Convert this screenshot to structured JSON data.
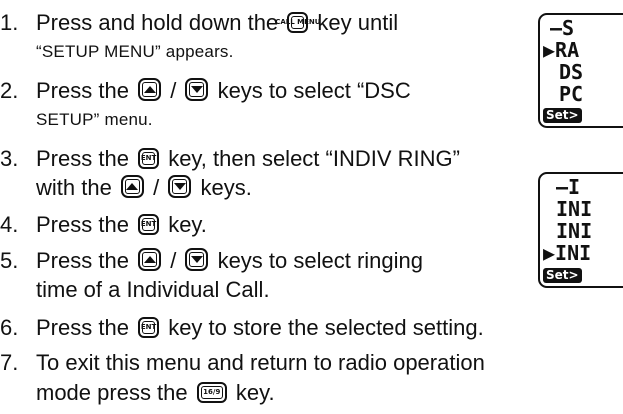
{
  "steps": [
    {
      "num": "1.",
      "a": "Press and hold down the",
      "key_label": "CALL MENU",
      "b": "key until",
      "c": "“SETUP MENU” appears."
    },
    {
      "num": "2.",
      "a": "Press the",
      "sep": "/",
      "b": "keys to select “DSC",
      "c": "SETUP” menu."
    },
    {
      "num": "3.",
      "a": "Press the",
      "key_label": "ENT",
      "b": "key, then select “INDIV RING”",
      "c": "with the",
      "sep": "/",
      "d": "keys."
    },
    {
      "num": "4.",
      "a": "Press the",
      "key_label": "ENT",
      "b": "key."
    },
    {
      "num": "5.",
      "a": "Press the",
      "sep": "/",
      "b": "keys to select ringing",
      "c": "time of a Individual Call."
    },
    {
      "num": "6.",
      "a": "Press the",
      "key_label": "ENT",
      "b": "key to store the selected setting."
    },
    {
      "num": "7.",
      "a": "To exit this menu and return to radio operation",
      "c": "mode press the",
      "key_label": "16/9",
      "d": "key."
    }
  ],
  "lcd_top": {
    "rows": [
      "—S",
      "▶RA",
      "DS",
      "PC"
    ],
    "softkey": "Set>"
  },
  "lcd_bottom": {
    "rows": [
      "—I",
      "INI",
      "INI",
      "▶INI"
    ],
    "softkey": "Set>"
  },
  "icons": {
    "up": "up-arrow-key-icon",
    "down": "down-arrow-key-icon",
    "call": "call-menu-key-icon",
    "ent": "ent-key-icon",
    "ch16": "16-9-key-icon"
  }
}
